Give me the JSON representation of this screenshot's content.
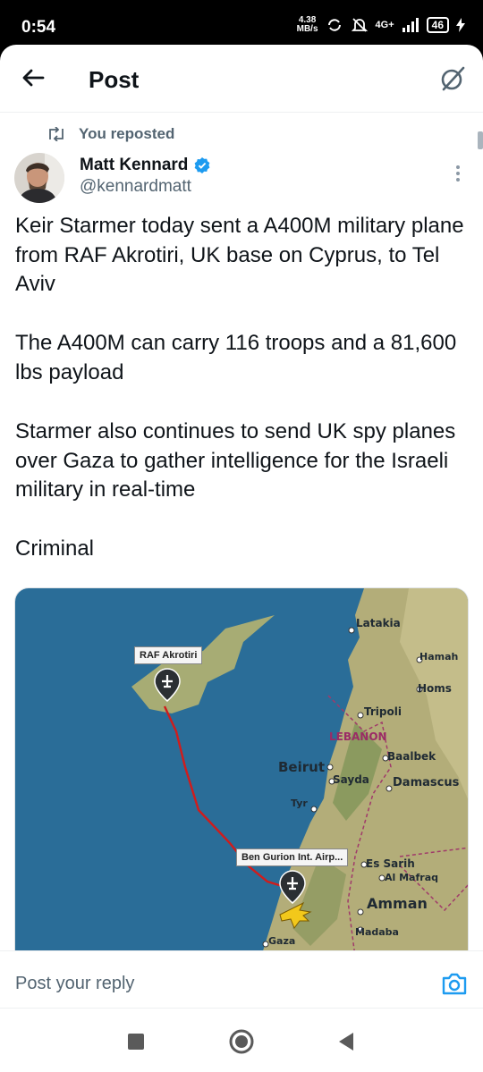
{
  "status_bar": {
    "time": "0:54",
    "speed_value": "4.38",
    "speed_unit": "MB/s",
    "network": "4G+",
    "battery": "46"
  },
  "header": {
    "title": "Post",
    "back_icon": "arrow-left-icon",
    "grok_icon": "grok-icon"
  },
  "post": {
    "repost_label": "You reposted",
    "author_name": "Matt Kennard",
    "author_handle": "@kennardmatt",
    "verified": true,
    "paragraphs": [
      "Keir Starmer today sent a A400M military plane from RAF Akrotiri, UK base on Cyprus, to Tel Aviv",
      "The A400M can carry 116 troops and a 81,600 lbs payload",
      "Starmer also continues to send UK spy planes over Gaza to gather intelligence for the Israeli military in real-time",
      "Criminal"
    ]
  },
  "map": {
    "colors": {
      "sea": "#2a6d98",
      "land": "#b3ad79",
      "route": "#d01c1c"
    },
    "callouts": {
      "origin": "RAF Akrotiri",
      "destination": "Ben Gurion Int. Airp..."
    },
    "places": {
      "latakia": "Latakia",
      "hamah": "Hamah",
      "homs": "Homs",
      "tripoli": "Tripoli",
      "lebanon": "LEBANON",
      "baalbek": "Baalbek",
      "beirut": "Beirut",
      "sayda": "Sayda",
      "damascus": "Damascus",
      "tyr": "Tyr",
      "es_sarih": "Es Sarih",
      "al_mafraq": "Al Mafraq",
      "amman": "Amman",
      "madaba": "Madaba",
      "gaza": "Gaza"
    }
  },
  "reply": {
    "placeholder": "Post your reply",
    "camera_icon": "camera-icon"
  },
  "nav": {
    "recents_icon": "square-icon",
    "home_icon": "circle-icon",
    "back_icon": "triangle-back-icon"
  }
}
